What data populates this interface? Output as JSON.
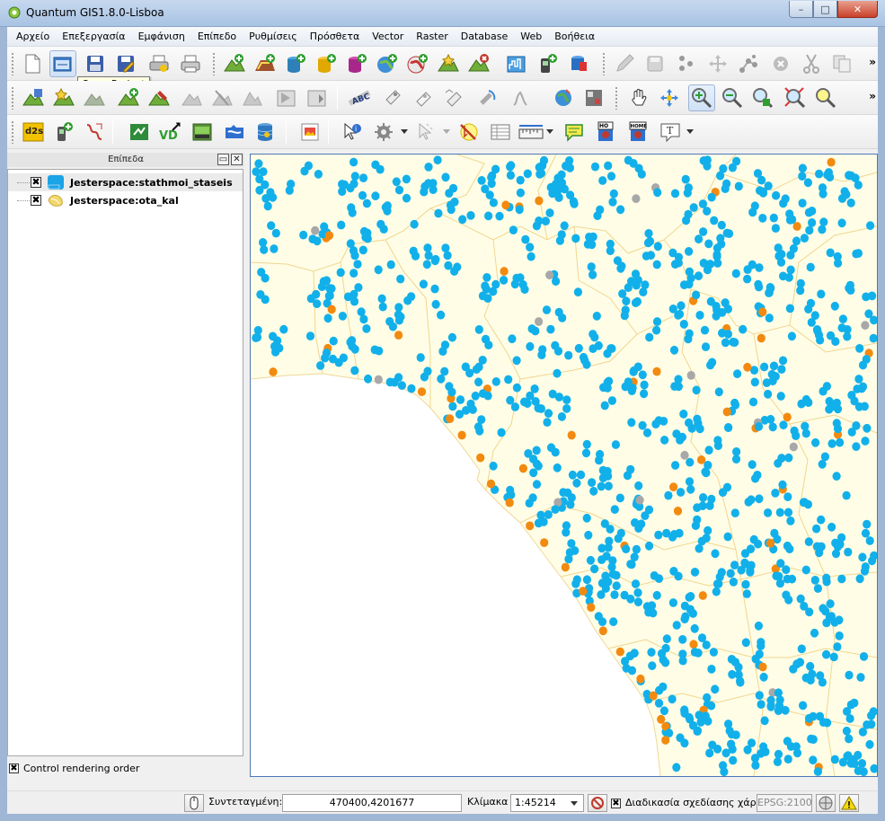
{
  "window": {
    "title": "Quantum GIS1.8.0-Lisboa",
    "buttons": {
      "minimize": "–",
      "maximize": "□",
      "close": "✕"
    }
  },
  "menubar": {
    "items": [
      "Αρχείο",
      "Επεξεργασία",
      "Εμφάνιση",
      "Επίπεδο",
      "Ρυθμίσεις",
      "Πρόσθετα",
      "Vector",
      "Raster",
      "Database",
      "Web",
      "Βοήθεια"
    ]
  },
  "tooltip": "Open Project",
  "toolbar_icons": {
    "row1": [
      "new-project-icon",
      "open-project-icon",
      "save-project-icon",
      "save-as-icon",
      "print-composer-icon",
      "print-icon",
      "add-vector-layer-icon",
      "add-raster-layer-icon",
      "add-postgis-layer-icon",
      "add-spatialite-layer-icon",
      "add-mssql-layer-icon",
      "add-wms-layer-icon",
      "add-wfs-layer-icon",
      "new-shapefile-icon",
      "remove-layer-icon",
      "add-wcs-layer-icon",
      "add-gps-layer-icon",
      "add-oracle-layer-icon",
      "edit-pencil-icon",
      "save-edits-icon",
      "add-feature-icon",
      "move-feature-icon",
      "node-tool-icon",
      "delete-selected-icon",
      "cut-features-icon",
      "copy-features-icon"
    ],
    "row2": [
      "layer-properties-icon",
      "favorite-icon",
      "merge-icon",
      "rotate-icon",
      "reshape-icon",
      "offset-icon",
      "split-icon",
      "simplify-icon",
      "add-ring-icon",
      "add-part-icon",
      "label-abc-icon",
      "pin-label-icon",
      "show-hide-label-icon",
      "move-label-icon",
      "rotate-label-icon",
      "change-label-icon",
      "globe-icon",
      "raster-calc-icon",
      "pan-hand-icon",
      "pan-to-selection-icon",
      "zoom-in-icon",
      "zoom-out-icon",
      "zoom-full-icon",
      "zoom-layer-icon",
      "zoom-selection-icon"
    ],
    "row3": [
      "d2s-icon",
      "gps-plugin-icon",
      "georeferencer-icon",
      "plugin-green-icon",
      "vd-icon",
      "save-image-icon",
      "mapserver-icon",
      "db-manager-icon",
      "composer-icon",
      "identify-icon",
      "run-feature-action-icon",
      "select-icon",
      "deselect-icon",
      "attribute-table-icon",
      "measure-icon",
      "map-tips-icon",
      "new-bookmark-icon",
      "show-bookmarks-icon",
      "text-annotation-icon"
    ],
    "more": "»",
    "d2s_label": "d2s",
    "vd_label": "VD",
    "abc_label": "ABC",
    "ho_label": "HO",
    "home_label": "HOME",
    "text_tool": "T"
  },
  "layers_panel": {
    "title": "Επίπεδα",
    "float_icon": "▭",
    "close_icon": "✕",
    "layers": [
      {
        "name": "Jesterspace:stathmoi_staseis",
        "checked": "✖",
        "icon_color": "#1aa3e6",
        "selected": true
      },
      {
        "name": "Jesterspace:ota_kal",
        "checked": "✖",
        "icon_color": "#f2d86a",
        "selected": false
      }
    ],
    "render_order": {
      "label": "Control rendering order",
      "checked": "✖"
    }
  },
  "map": {
    "background": "#fffde6",
    "land_color": "#fffbe0",
    "sea_color": "#ffffff",
    "boundary_color": "#efd79a",
    "point_colors": {
      "stations": "#12b0ea",
      "orange": "#f28a0f",
      "grey": "#a8a8a8"
    }
  },
  "statusbar": {
    "coord_label": "Συντεταγμένη:",
    "coord_value": "470400,4201677",
    "scale_label": "Κλίμακα",
    "scale_value": "1:45214",
    "render_checked": "✖",
    "render_label": "Διαδικασία σχεδίασης χάρτη",
    "epsg": "EPSG:2100"
  }
}
